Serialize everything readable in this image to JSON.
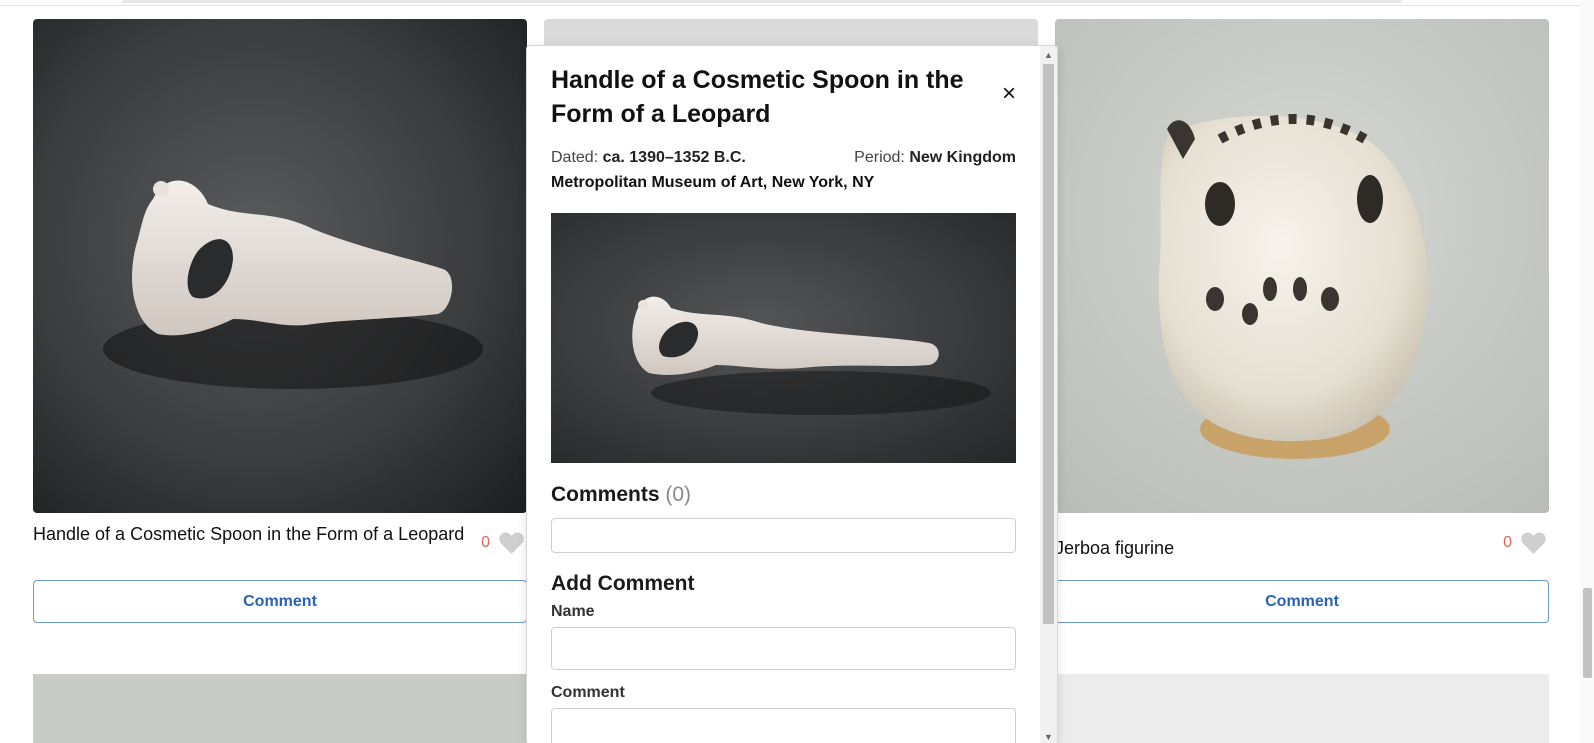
{
  "cards": [
    {
      "title": "Handle of a Cosmetic Spoon in the Form of a Leopard",
      "likes": "0",
      "button_label": "Comment"
    },
    {
      "title": "",
      "likes": "",
      "button_label": ""
    },
    {
      "title": "Jerboa figurine",
      "likes": "0",
      "button_label": "Comment"
    }
  ],
  "modal": {
    "title": "Handle of a Cosmetic Spoon in the Form of a Leopard",
    "close_label": "×",
    "dated_label": "Dated:",
    "dated_value": "ca. 1390–1352 B.C.",
    "period_label": "Period:",
    "period_value": "New Kingdom",
    "museum": "Metropolitan Museum of Art, New York, NY",
    "comments_heading": "Comments",
    "comments_count": "(0)",
    "add_comment_heading": "Add Comment",
    "name_label": "Name",
    "comment_label": "Comment",
    "name_value": "",
    "comment_value": ""
  },
  "colors": {
    "accent": "#2a62b5",
    "like_count": "#e0665f",
    "heart": "#cfcfcf"
  },
  "icons": {
    "like": "heart-icon",
    "close": "close-icon",
    "scroll_up": "scroll-up-arrow-icon",
    "scroll_down": "scroll-down-arrow-icon"
  }
}
